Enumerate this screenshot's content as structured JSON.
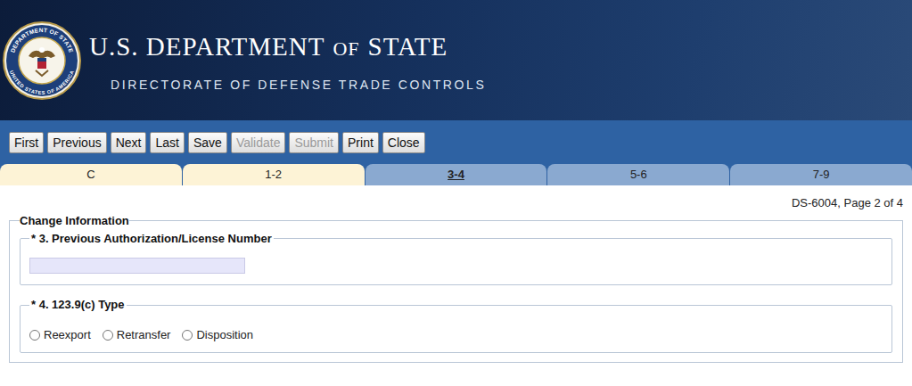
{
  "header": {
    "seal": {
      "top_text": "DEPARTMENT OF STATE",
      "bottom_text": "UNITED STATES OF AMERICA"
    },
    "title": [
      {
        "text": "U.S. DEPARTMENT",
        "small": false
      },
      {
        "text": "OF",
        "small": true
      },
      {
        "text": "STATE",
        "small": false
      }
    ],
    "subtitle": "DIRECTORATE OF DEFENSE TRADE CONTROLS"
  },
  "toolbar": {
    "buttons": [
      {
        "label": "First",
        "disabled": false
      },
      {
        "label": "Previous",
        "disabled": false
      },
      {
        "label": "Next",
        "disabled": false
      },
      {
        "label": "Last",
        "disabled": false
      },
      {
        "label": "Save",
        "disabled": false
      },
      {
        "label": "Validate",
        "disabled": true
      },
      {
        "label": "Submit",
        "disabled": true
      },
      {
        "label": "Print",
        "disabled": false
      },
      {
        "label": "Close",
        "disabled": false
      }
    ]
  },
  "tabs": [
    {
      "label": "C",
      "selected": false,
      "visited": true
    },
    {
      "label": "1-2",
      "selected": false,
      "visited": true
    },
    {
      "label": "3-4",
      "selected": true,
      "visited": false
    },
    {
      "label": "5-6",
      "selected": false,
      "visited": false
    },
    {
      "label": "7-9",
      "selected": false,
      "visited": false
    }
  ],
  "page_label": "DS-6004, Page 2 of 4",
  "section": {
    "legend": "Change Information",
    "fields": [
      {
        "kind": "text",
        "label": "* 3. Previous Authorization/License Number",
        "value": ""
      },
      {
        "kind": "radio",
        "label": "* 4. 123.9(c) Type",
        "options": [
          {
            "label": "Reexport",
            "selected": false
          },
          {
            "label": "Retransfer",
            "selected": false
          },
          {
            "label": "Disposition",
            "selected": false
          }
        ]
      }
    ]
  }
}
